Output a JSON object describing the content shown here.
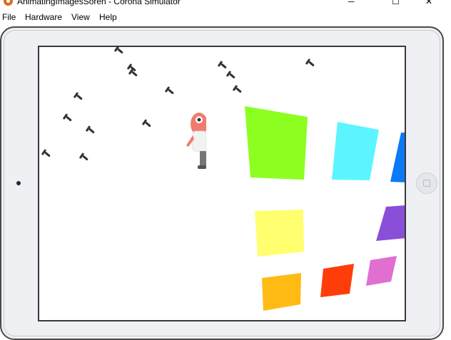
{
  "window": {
    "title": "AnimatingImagesSoren - Corona Simulator",
    "controls": {
      "minimize": "─",
      "maximize": "☐",
      "close": "✕"
    }
  },
  "menu": [
    "File",
    "Hardware",
    "View",
    "Help"
  ],
  "colors": {
    "green": "#8cff21",
    "cyan": "#5cf5ff",
    "blue": "#0a7af7",
    "yellow": "#ffff70",
    "purple": "#8a4fd9",
    "orange": "#ffba14",
    "red": "#ff3d0b",
    "pink": "#e06fd0",
    "bird": "#333333",
    "character_skin": "#f07b6e"
  },
  "icons": {
    "app": "corona-app-icon",
    "home": "home-button-icon",
    "camera": "front-camera-icon"
  }
}
